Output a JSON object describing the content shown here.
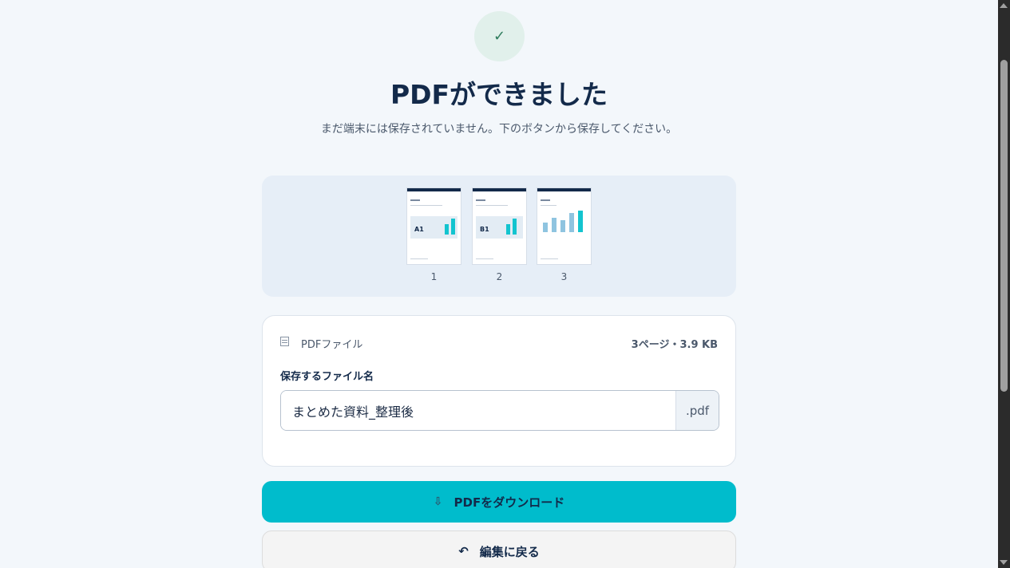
{
  "success_icon": "check-icon",
  "check_glyph": "✓",
  "title": "PDFができました",
  "subtitle": "まだ端末には保存されていません。下のボタンから保存してください。",
  "preview": {
    "pages": [
      {
        "number": "1",
        "box_label": "A1"
      },
      {
        "number": "2",
        "box_label": "B1"
      },
      {
        "number": "3",
        "box_label": ""
      }
    ]
  },
  "file_card": {
    "type_label": "PDFファイル",
    "meta": "3ページ・3.9 KB",
    "field_label": "保存するファイル名",
    "filename_value": "まとめた資料_整理後",
    "extension": ".pdf"
  },
  "actions": {
    "download_icon": "⇩",
    "download_label": "PDFをダウンロード",
    "back_icon": "↶",
    "back_label": "編集に戻る"
  },
  "colors": {
    "accent": "#00bccc",
    "title": "#132a4a",
    "success_bg": "#e1f0eb"
  }
}
